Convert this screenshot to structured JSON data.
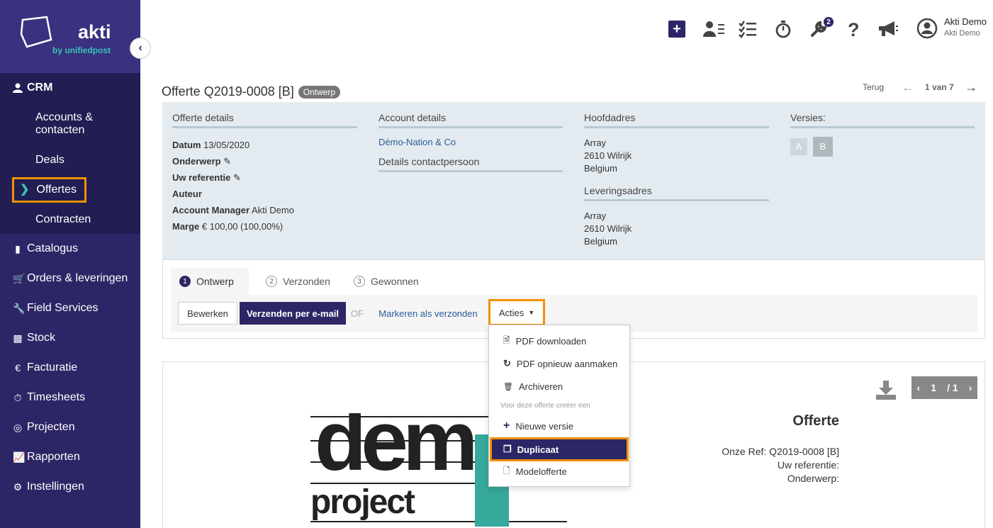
{
  "brand": {
    "name": "akti",
    "tagline": "by unifiedpost"
  },
  "sidebar": {
    "crm_label": "CRM",
    "crm_items": [
      {
        "label": "Accounts & contacten"
      },
      {
        "label": "Deals"
      },
      {
        "label": "Offertes"
      },
      {
        "label": "Contracten"
      }
    ],
    "items": [
      {
        "label": "Catalogus",
        "icon": "book-icon"
      },
      {
        "label": "Orders & leveringen",
        "icon": "cart-icon"
      },
      {
        "label": "Field Services",
        "icon": "wrench-icon"
      },
      {
        "label": "Stock",
        "icon": "cubes-icon"
      },
      {
        "label": "Facturatie",
        "icon": "euro-icon"
      },
      {
        "label": "Timesheets",
        "icon": "stopwatch-icon"
      },
      {
        "label": "Projecten",
        "icon": "target-icon"
      },
      {
        "label": "Rapporten",
        "icon": "chart-icon"
      },
      {
        "label": "Instellingen",
        "icon": "gear-icon"
      }
    ]
  },
  "header": {
    "notification_count": "2",
    "user_name": "Akti Demo",
    "user_company": "Akti Demo"
  },
  "page": {
    "title": "Offerte Q2019-0008 [B]",
    "status": "Ontwerp",
    "back_label": "Terug",
    "pager": "1 van 7"
  },
  "details": {
    "offer_heading": "Offerte details",
    "datum_label": "Datum",
    "datum_value": "13/05/2020",
    "onderwerp_label": "Onderwerp",
    "referentie_label": "Uw referentie",
    "auteur_label": "Auteur",
    "manager_label": "Account Manager",
    "manager_value": "Akti Demo",
    "marge_label": "Marge",
    "marge_value": "€ 100,00 (100,00%)",
    "account_heading": "Account details",
    "account_name": "Démo-Nation & Co",
    "contact_heading": "Details contactpersoon",
    "main_address_heading": "Hoofdadres",
    "main_address": [
      "Array",
      "2610 Wilrijk",
      "Belgium"
    ],
    "delivery_heading": "Leveringsadres",
    "delivery_address": [
      "Array",
      "2610 Wilrijk",
      "Belgium"
    ],
    "versions_heading": "Versies:",
    "versions": [
      "A",
      "B"
    ]
  },
  "steps": [
    {
      "num": "1",
      "label": "Ontwerp"
    },
    {
      "num": "2",
      "label": "Verzonden"
    },
    {
      "num": "3",
      "label": "Gewonnen"
    }
  ],
  "actions": {
    "edit": "Bewerken",
    "send_email": "Verzenden per e-mail",
    "or": "OF",
    "mark_sent": "Markeren als verzonden",
    "acties": "Acties"
  },
  "dropdown": {
    "items_top": [
      "PDF downloaden",
      "PDF opnieuw aanmaken",
      "Archiveren"
    ],
    "section_header": "Voor deze offerte creëer een",
    "items_bottom": [
      "Nieuwe versie",
      "Duplicaat",
      "Modelofferte"
    ]
  },
  "preview": {
    "page_current": "1",
    "page_total": "/ 1",
    "doc_title": "Offerte",
    "ref_line": "Onze Ref: Q2019-0008 [B]",
    "uw_ref_line": "Uw referentie:",
    "onderwerp_line": "Onderwerp:",
    "logo_text_top": "dem",
    "logo_text_bottom": "project"
  },
  "colors": {
    "sidebar": "#2d2666",
    "accent": "#36c4b4",
    "highlight": "#f29100"
  }
}
